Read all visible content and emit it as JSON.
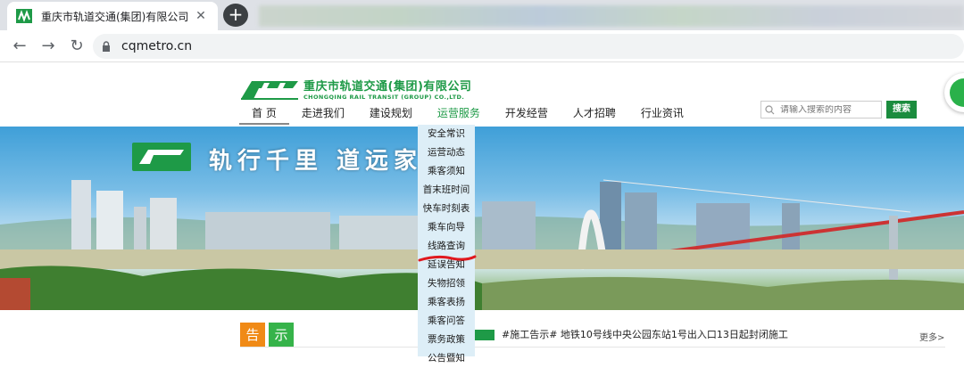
{
  "browser": {
    "tab_title": "重庆市轨道交通(集团)有限公司",
    "tab_close": "✕",
    "new_tab": "+",
    "url": "cqmetro.cn",
    "back": "←",
    "forward": "→",
    "reload": "↻"
  },
  "site": {
    "logo_cn": "重庆市轨道交通(集团)有限公司",
    "logo_en": "CHONGQING RAIL TRANSIT (GROUP) CO.,LTD.",
    "nav": [
      "首 页",
      "走进我们",
      "建设规划",
      "运营服务",
      "开发经营",
      "人才招聘",
      "行业资讯"
    ],
    "search_placeholder": "请输入搜索的内容",
    "search_button": "搜索",
    "slogan": "轨行千里 道远家",
    "dropdown": [
      "安全常识",
      "运营动态",
      "乘客须知",
      "首末班时间",
      "快车时刻表",
      "乘车向导",
      "线路查询",
      "延误告知",
      "失物招领",
      "乘客表扬",
      "乘客问答",
      "票务政策",
      "公告暨知"
    ],
    "notice_tag_1": "告",
    "notice_tag_2": "示",
    "notice_text": "#施工告示# 地铁10号线中央公园东站1号出入口13日起封闭施工",
    "more": "更多>"
  },
  "colors": {
    "brand_green": "#1e9a47",
    "accent_orange": "#f08a16",
    "dropdown_bg": "#ddeef7"
  }
}
